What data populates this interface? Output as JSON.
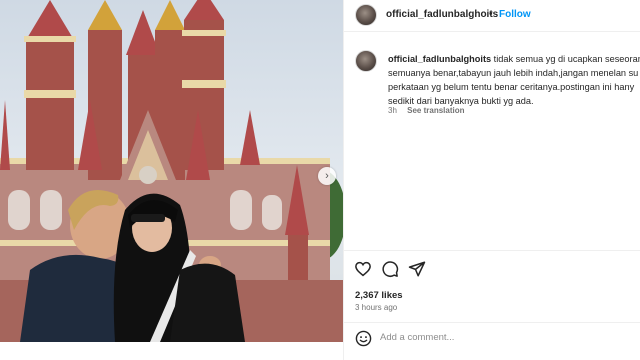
{
  "post": {
    "username": "official_fadlunbalghoits",
    "separator": "•",
    "follow_label": "Follow",
    "caption_lines": [
      "tidak semua yg di ucapkan seseoran",
      "semuanya benar,tabayun jauh lebih indah,jangan menelan su",
      "perkataan yg belum tentu benar ceritanya.postingan ini hany",
      "sedikit dari banyaknya bukti yg ada."
    ],
    "caption_age": "3h",
    "see_translation_label": "See translation",
    "likes": "2,367 likes",
    "posted_time": "3 hours ago",
    "comment_placeholder": "Add a comment..."
  },
  "icons": {
    "like": "heart-icon",
    "comment": "comment-bubble-icon",
    "share": "share-paper-plane-icon",
    "emoji": "emoji-smiley-icon",
    "carousel_next": "chevron-right-icon"
  },
  "colors": {
    "follow_blue": "#0095f6",
    "secondary_text": "#737373",
    "primary_text": "#262626",
    "castle_roof": "#b04a4a",
    "castle_wall": "#b9887f",
    "castle_trim": "#e9d9a8"
  }
}
